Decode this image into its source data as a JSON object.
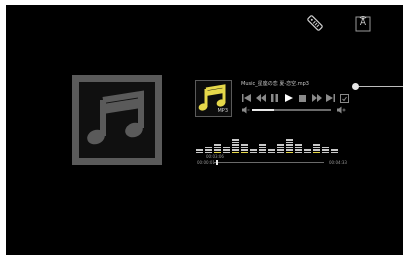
{
  "icons": {
    "remote": "remote-icon",
    "input_source": "input-source-icon",
    "input_label": "A"
  },
  "colors": {
    "background": "#000000",
    "accent_yellow": "#e6d84a",
    "control_gray": "#8a8a8a",
    "play_white": "#ffffff"
  },
  "now_playing": {
    "title": "Music_星座の恋 夏-恋空.mp3",
    "thumb_format": "MP3",
    "time_label": "00:03:06",
    "elapsed": "00:00:01",
    "duration": "00:04:33",
    "progress_fraction": 0.02,
    "volume_fraction": 0.28,
    "side_slider_fraction": 0.0
  },
  "controls": [
    {
      "name": "previous-track-button",
      "icon": "skip-previous-icon"
    },
    {
      "name": "rewind-button",
      "icon": "rewind-icon"
    },
    {
      "name": "pause-button",
      "icon": "pause-icon"
    },
    {
      "name": "play-button",
      "icon": "play-icon"
    },
    {
      "name": "stop-button",
      "icon": "stop-icon"
    },
    {
      "name": "fast-forward-button",
      "icon": "fast-forward-icon"
    },
    {
      "name": "next-track-button",
      "icon": "skip-next-icon"
    },
    {
      "name": "repeat-button",
      "icon": "repeat-icon"
    }
  ],
  "equalizer_levels": [
    0.35,
    0.45,
    0.55,
    0.45,
    0.9,
    0.55,
    0.3,
    0.5,
    0.25,
    0.5,
    0.85,
    0.5,
    0.35,
    0.6,
    0.45,
    0.3
  ]
}
